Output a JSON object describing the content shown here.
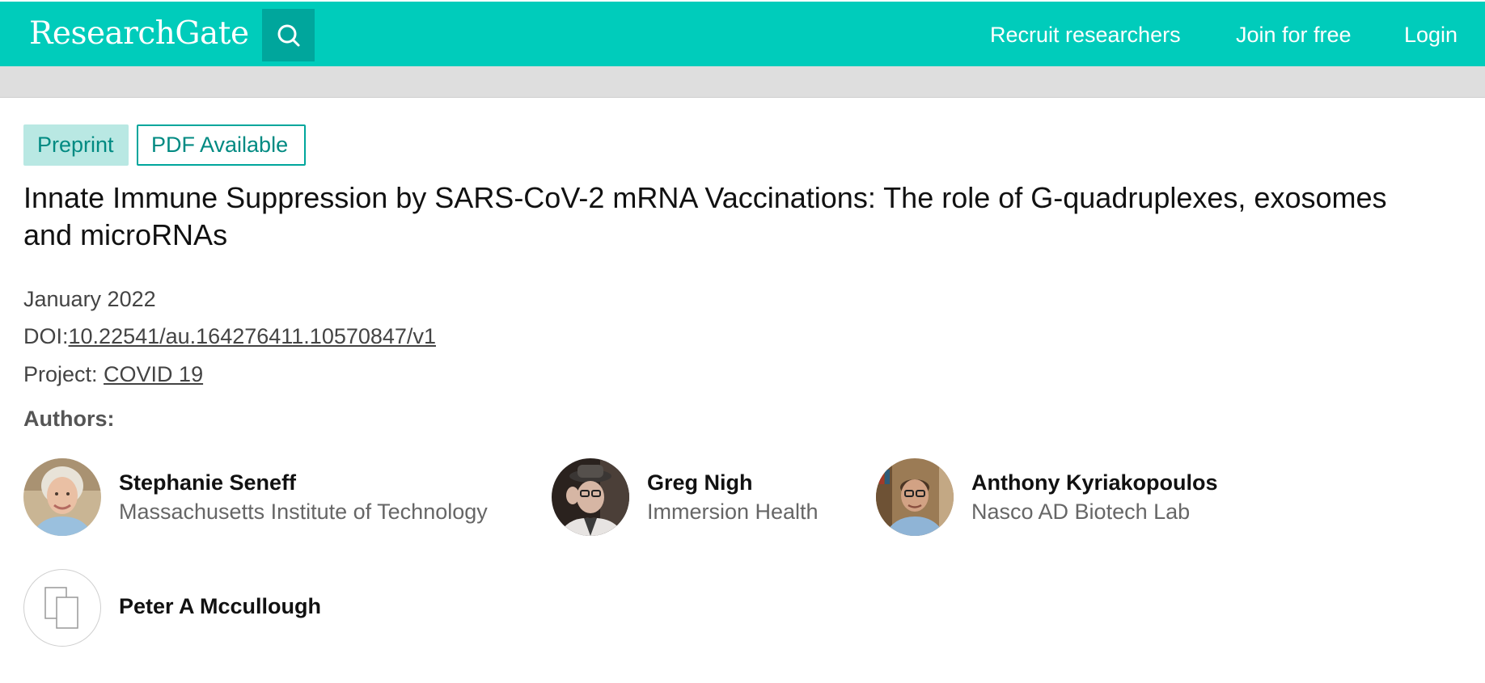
{
  "header": {
    "logo": "ResearchGate",
    "search_icon": "search-icon",
    "nav": {
      "recruit": "Recruit researchers",
      "join": "Join for free",
      "login": "Login"
    },
    "colors": {
      "bar": "#00ccbb",
      "search_button": "#00a69c"
    }
  },
  "publication": {
    "badges": {
      "type": "Preprint",
      "pdf": "PDF Available"
    },
    "title": "Innate Immune Suppression by SARS-CoV-2 mRNA Vaccinations: The role of G-quadruplexes, exosomes and microRNAs",
    "date": "January 2022",
    "doi_label": "DOI:",
    "doi_value": "10.22541/au.164276411.10570847/v1",
    "project_label": "Project: ",
    "project_value": "COVID 19"
  },
  "authors": {
    "heading": "Authors:",
    "list": [
      {
        "name": "Stephanie Seneff",
        "institution": "Massachusetts Institute of Technology",
        "avatar": "photo"
      },
      {
        "name": "Greg Nigh",
        "institution": "Immersion Health",
        "avatar": "photo"
      },
      {
        "name": "Anthony Kyriakopoulos",
        "institution": "Nasco AD Biotech Lab",
        "avatar": "photo"
      },
      {
        "name": "Peter A Mccullough",
        "institution": "",
        "avatar": "placeholder-icon"
      }
    ]
  }
}
